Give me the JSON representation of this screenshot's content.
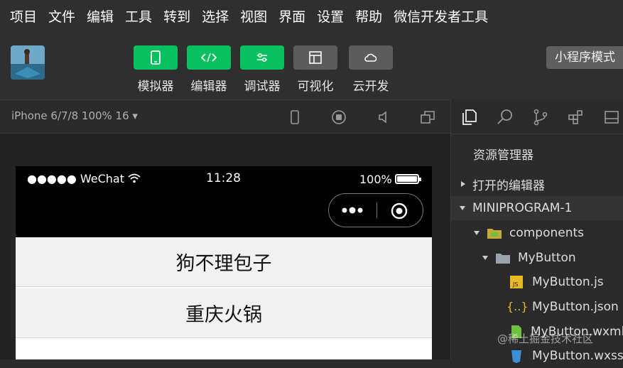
{
  "menu": [
    "项目",
    "文件",
    "编辑",
    "工具",
    "转到",
    "选择",
    "视图",
    "界面",
    "设置",
    "帮助",
    "微信开发者工具"
  ],
  "toolbar": {
    "tools": [
      {
        "label": "模拟器",
        "icon": "phone-icon",
        "active": true
      },
      {
        "label": "编辑器",
        "icon": "code-icon",
        "active": true
      },
      {
        "label": "调试器",
        "icon": "sliders-icon",
        "active": true
      },
      {
        "label": "可视化",
        "icon": "layout-icon",
        "active": false
      },
      {
        "label": "云开发",
        "icon": "cloud-icon",
        "active": false
      }
    ],
    "mode_label": "小程序模式",
    "accent": "#07c160"
  },
  "simulator": {
    "device_label": "iPhone 6/7/8 100% 16 ▾",
    "status": {
      "carrier": "●●●●● WeChat",
      "time": "11:28",
      "battery": "100%",
      "battery_level": 1.0
    },
    "list_items": [
      "狗不理包子",
      "重庆火锅"
    ]
  },
  "explorer": {
    "title": "资源管理器",
    "rows": [
      {
        "label": "打开的编辑器",
        "type": "section-collapsed"
      },
      {
        "label": "MINIPROGRAM-1",
        "type": "section-expanded"
      },
      {
        "label": "components",
        "type": "folder-open",
        "icon": "folder-icon"
      },
      {
        "label": "MyButton",
        "type": "folder-open",
        "icon": "folder-icon"
      },
      {
        "label": "MyButton.js",
        "type": "file",
        "icon": "js-file-icon"
      },
      {
        "label": "MyButton.json",
        "type": "file",
        "icon": "json-file-icon"
      },
      {
        "label": "MyButton.wxml",
        "type": "file",
        "icon": "wxml-file-icon"
      },
      {
        "label": "MyButton.wxss",
        "type": "file",
        "icon": "css-file-icon"
      }
    ]
  },
  "watermark": "@稀土掘金技术社区"
}
